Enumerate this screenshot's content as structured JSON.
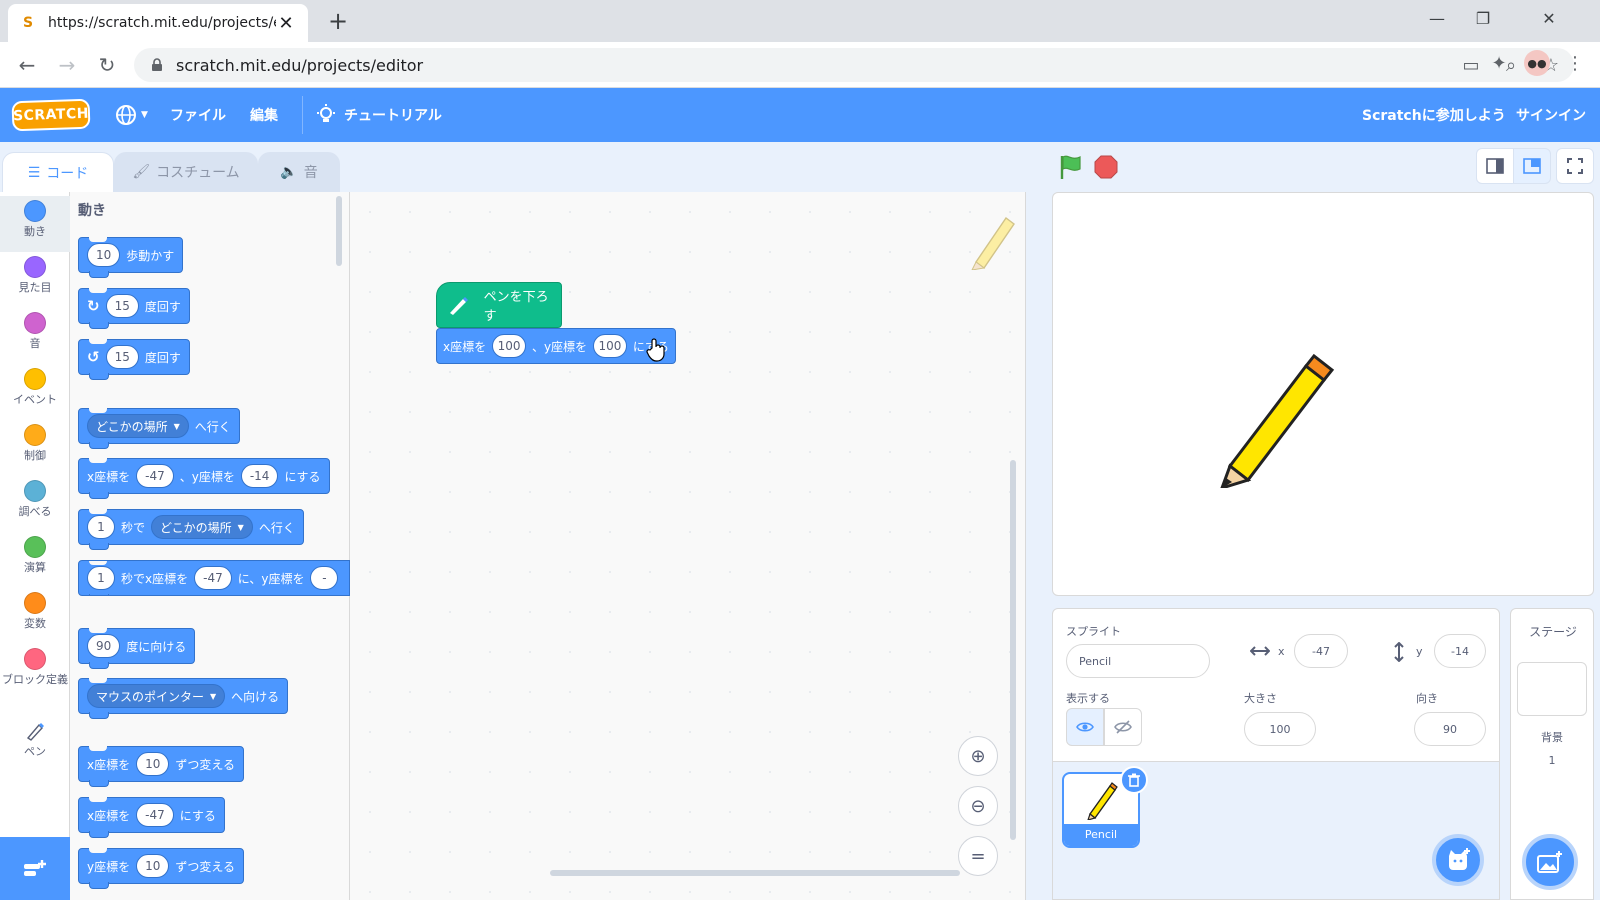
{
  "browser": {
    "tab_title": "https://scratch.mit.edu/projects/e",
    "url": "scratch.mit.edu/projects/editor"
  },
  "menubar": {
    "logo": "SCRATCH",
    "file": "ファイル",
    "edit": "編集",
    "tutorials": "チュートリアル",
    "join": "Scratchに参加しよう",
    "signin": "サインイン"
  },
  "editor_tabs": {
    "code": "コード",
    "costumes": "コスチューム",
    "sounds": "音"
  },
  "categories": [
    {
      "label": "動き",
      "color": "#4c97ff"
    },
    {
      "label": "見た目",
      "color": "#9966ff"
    },
    {
      "label": "音",
      "color": "#cf63cf"
    },
    {
      "label": "イベント",
      "color": "#ffbf00"
    },
    {
      "label": "制御",
      "color": "#ffab19"
    },
    {
      "label": "調べる",
      "color": "#5cb1d6"
    },
    {
      "label": "演算",
      "color": "#59c059"
    },
    {
      "label": "変数",
      "color": "#ff8c1a"
    },
    {
      "label": "ブロック定義",
      "color": "#ff6680"
    },
    {
      "label": "ペン",
      "color": "#0fbd8c"
    }
  ],
  "palette": {
    "heading": "動き",
    "blocks": {
      "move_steps": "10",
      "move_label": "歩動かす",
      "turn_right_deg": "15",
      "turn_label": "度回す",
      "turn_left_deg": "15",
      "goto_target": "どこかの場所",
      "goto_label": "へ行く",
      "x_label": "x座標を",
      "x_val": "-47",
      "y_label": "、y座標を",
      "y_val": "-14",
      "set_label": "にする",
      "glide_secs": "1",
      "glide_sec_label": "秒で",
      "glide_target": "どこかの場所",
      "glide_xy_label": "秒でx座標を",
      "glide_x": "-47",
      "glide_y_label": "に、y座標を",
      "point_deg": "90",
      "point_label": "度に向ける",
      "point_towards": "マウスのポインター",
      "towards_label": "へ向ける",
      "change_x_label": "x座標を",
      "change_x": "10",
      "change_label": "ずつ変える",
      "set_x_label": "x座標を",
      "set_x": "-47",
      "change_y_label": "y座標を",
      "change_y": "10"
    }
  },
  "script": {
    "pen_down": "ペンを下ろす",
    "x_label": "x座標を",
    "x": "100",
    "y_label": "、y座標を",
    "y": "100",
    "suffix": "にする"
  },
  "sprite_info": {
    "sprite_label": "スプライト",
    "name": "Pencil",
    "x_label": "x",
    "x": "-47",
    "y_label": "y",
    "y": "-14",
    "show_label": "表示する",
    "size_label": "大きさ",
    "size": "100",
    "direction_label": "向き",
    "direction": "90"
  },
  "sprites": [
    {
      "name": "Pencil"
    }
  ],
  "stage_panel": {
    "title": "ステージ",
    "backdrops_label": "背景",
    "backdrops_count": "1"
  },
  "colors": {
    "accent": "#4c97ff",
    "pen": "#0fbd8c",
    "flag": "#4cbf56",
    "stop": "#ec5959"
  }
}
